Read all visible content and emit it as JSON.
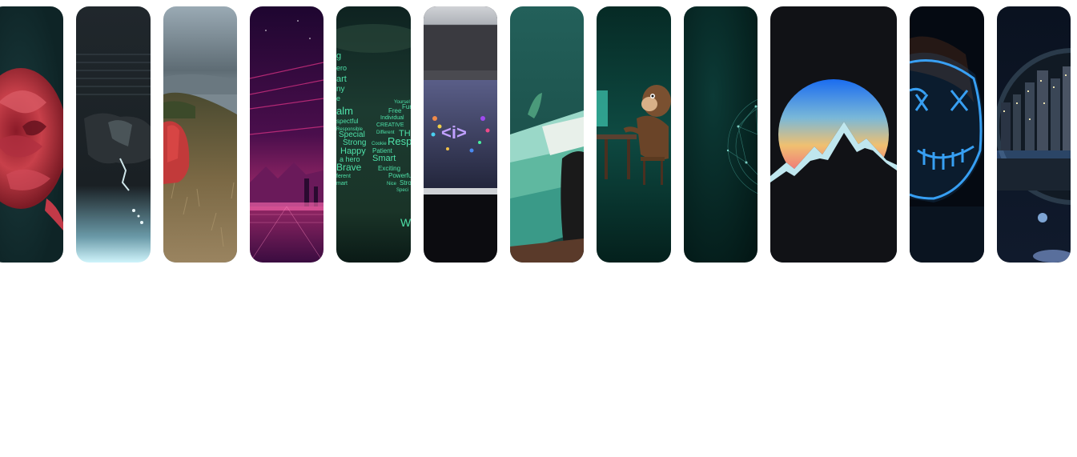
{
  "gallery": {
    "cards": [
      {
        "subject": "red-rose",
        "colors": {
          "bg": "#123033",
          "accent": "#c8404a"
        }
      },
      {
        "subject": "hooded-figure-glitch",
        "colors": {
          "bg": "#1c2226",
          "accent": "#bfe8f2"
        }
      },
      {
        "subject": "person-red-jacket-hillside",
        "colors": {
          "bg": "#6c7a82",
          "accent": "#c23a3a"
        }
      },
      {
        "subject": "synthwave-landscape",
        "colors": {
          "bg": "#2a0a3a",
          "accent": "#e0408a"
        }
      },
      {
        "subject": "word-cloud",
        "colors": {
          "bg": "#14302a",
          "accent": "#4ee0a8"
        },
        "words": [
          "g",
          "ero",
          "art",
          "ny",
          "e",
          "alm",
          "Free",
          "Fun",
          "Yoursel",
          "Individual",
          "spectful",
          "Responsible",
          "CREATIVE",
          "Different",
          "THE",
          "Special",
          "Strong",
          "Cookie",
          "Resp",
          "Happy",
          "Patient",
          "a hero",
          "Smart",
          "Brave",
          "Exciting",
          "ferent",
          "Powerful",
          "mart",
          "Nice",
          "Stro",
          "Speci",
          "W"
        ]
      },
      {
        "subject": "laptop-code-art",
        "colors": {
          "bg": "#0c0c10",
          "accent": "#9aa0c8"
        },
        "glyph": "<i>"
      },
      {
        "subject": "person-on-laptop-teal",
        "colors": {
          "bg": "#1e5a52",
          "accent": "#7fd6c0"
        }
      },
      {
        "subject": "monkey-at-computer",
        "colors": {
          "bg": "#062a25",
          "accent": "#3ec8b0"
        }
      },
      {
        "subject": "network-sphere",
        "colors": {
          "bg": "#062a28",
          "accent": "#3a8a80"
        }
      },
      {
        "subject": "mountain-sun",
        "colors": {
          "bg": "#111216",
          "sun_top": "#1a6cf0",
          "sun_mid": "#f0c070",
          "sun_bottom": "#f04080",
          "peak": "#bfe6ee"
        }
      },
      {
        "subject": "neon-mask",
        "colors": {
          "bg": "#050a12",
          "accent": "#3aa8ff"
        }
      },
      {
        "subject": "city-lens",
        "colors": {
          "bg": "#0a1220",
          "accent": "#6aa8ff"
        }
      }
    ]
  }
}
